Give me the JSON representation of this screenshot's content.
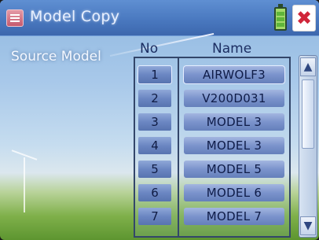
{
  "header": {
    "title": "Model Copy",
    "icons": {
      "left": "model-list-icon",
      "battery": "battery-icon",
      "tool": "tool-icon"
    }
  },
  "source_label": "Source Model",
  "columns": {
    "no": "No",
    "name": "Name"
  },
  "models": [
    {
      "no": "1",
      "name": "AIRWOLF3"
    },
    {
      "no": "2",
      "name": "V200D031"
    },
    {
      "no": "3",
      "name": "MODEL 3"
    },
    {
      "no": "4",
      "name": "MODEL 3"
    },
    {
      "no": "5",
      "name": "MODEL 5"
    },
    {
      "no": "6",
      "name": "MODEL 6"
    },
    {
      "no": "7",
      "name": "MODEL 7"
    }
  ],
  "scroll": {
    "up": "▲",
    "down": "▼"
  },
  "colors": {
    "title_bar": "#4a79c0",
    "cell": "#6b86c2",
    "text": "#1c2e62"
  }
}
